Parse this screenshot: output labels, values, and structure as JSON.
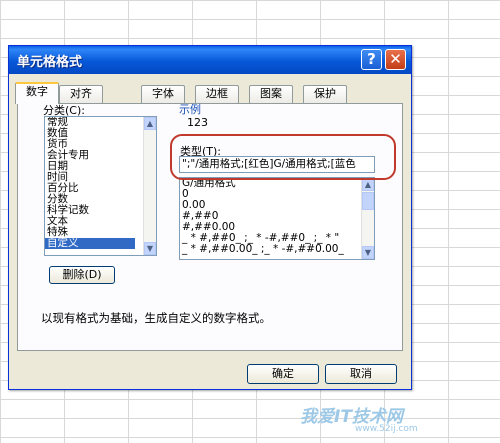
{
  "dialog": {
    "title": "单元格格式",
    "help_icon": "?",
    "close_icon": "✕"
  },
  "tabs": [
    {
      "label": "数字",
      "active": true
    },
    {
      "label": "对齐"
    },
    {
      "label": "字体"
    },
    {
      "label": "边框"
    },
    {
      "label": "图案"
    },
    {
      "label": "保护"
    }
  ],
  "category": {
    "label": "分类(C):",
    "items": [
      "常规",
      "数值",
      "货币",
      "会计专用",
      "日期",
      "时间",
      "百分比",
      "分数",
      "科学记数",
      "文本",
      "特殊",
      "自定义"
    ],
    "selected": "自定义"
  },
  "sample": {
    "label": "示例",
    "value": "123"
  },
  "type": {
    "label": "类型(T):",
    "value": "\";\"/通用格式;[红色]G/通用格式;[蓝色",
    "list": [
      "G/通用格式",
      "0",
      "0.00",
      "#,##0",
      "#,##0.00",
      "_ * #,##0_ ;_ * -#,##0_ ;_ * \"",
      "_ * #,##0.00_ ;_ * -#,##0.00_"
    ]
  },
  "delete_button": "删除(D)",
  "description": "以现有格式为基础，生成自定义的数字格式。",
  "ok_button": "确定",
  "cancel_button": "取消",
  "watermark": {
    "main": "我爱IT技术网",
    "sub": "www.52ij.com"
  }
}
